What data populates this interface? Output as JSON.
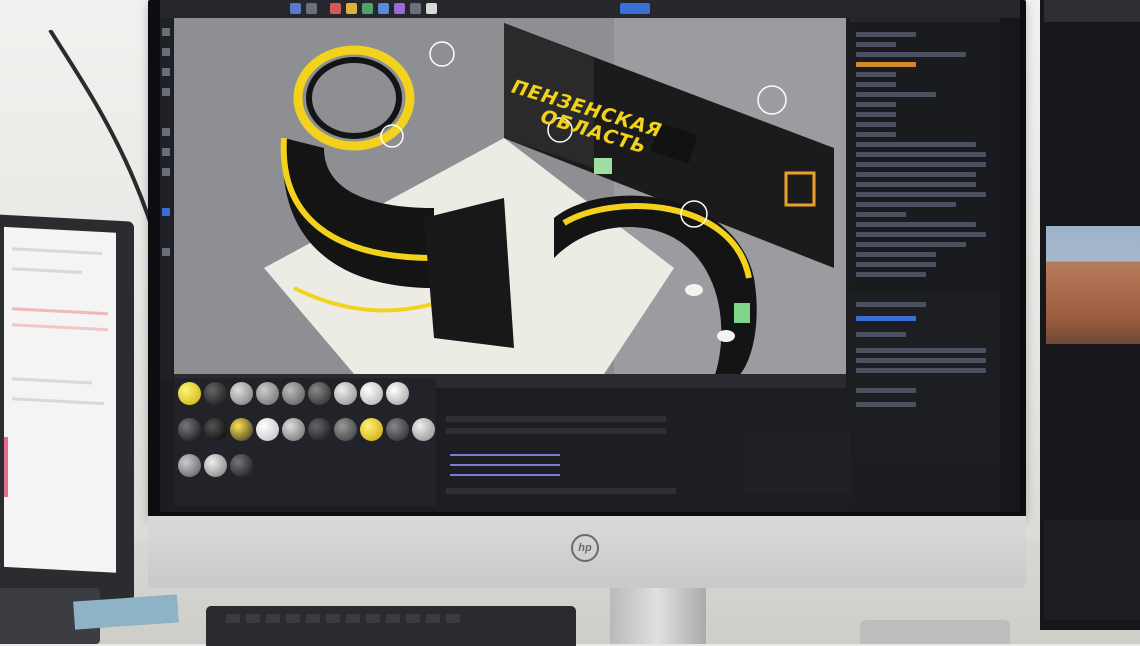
{
  "scene": {
    "monitor_brand": "hp",
    "application": "3D modelling software (Cinema 4D style interface)",
    "sign_text_line1": "ПЕНЗЕНСКАЯ",
    "sign_text_line2": "ОБЛАСТЬ"
  },
  "colors": {
    "accent_yellow": "#f2d21c",
    "booth_black": "#141414",
    "viewport_grey": "#8d8f93",
    "ui_dark": "#1c1d21",
    "selection_blue": "#3a6fd8"
  },
  "icons": [
    "hp-logo-icon",
    "play-icon",
    "record-icon",
    "move-icon",
    "rotate-icon",
    "scale-icon"
  ]
}
